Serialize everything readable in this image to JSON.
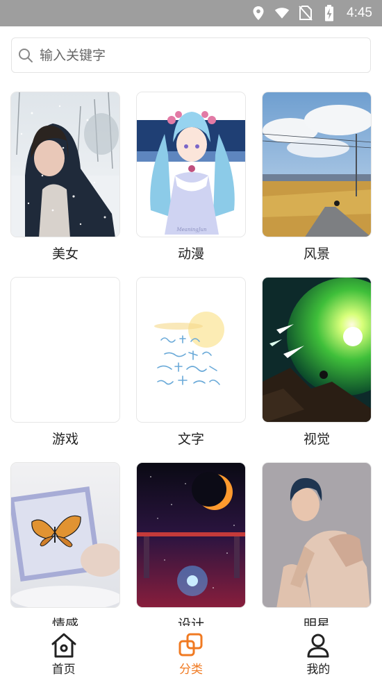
{
  "status_bar": {
    "time": "4:45",
    "icons": [
      "location-icon",
      "wifi-icon",
      "no-sim-icon",
      "battery-charging-icon"
    ]
  },
  "search": {
    "placeholder": "输入关键字"
  },
  "categories": [
    {
      "label": "美女",
      "image": "snowy-portrait-photo"
    },
    {
      "label": "动漫",
      "image": "anime-girl-illustration"
    },
    {
      "label": "风景",
      "image": "country-road-landscape"
    },
    {
      "label": "游戏",
      "image": "blank-white"
    },
    {
      "label": "文字",
      "image": "handwritten-text-art"
    },
    {
      "label": "视觉",
      "image": "green-planet-space-art"
    },
    {
      "label": "情感",
      "image": "butterfly-frame-photo"
    },
    {
      "label": "设计",
      "image": "crescent-moon-space-art"
    },
    {
      "label": "明星",
      "image": "male-model-portrait"
    }
  ],
  "bottom_nav": {
    "items": [
      {
        "label": "首页",
        "icon": "home-icon",
        "active": false
      },
      {
        "label": "分类",
        "icon": "category-icon",
        "active": true
      },
      {
        "label": "我的",
        "icon": "user-icon",
        "active": false
      }
    ],
    "active_color": "#f07a22"
  }
}
